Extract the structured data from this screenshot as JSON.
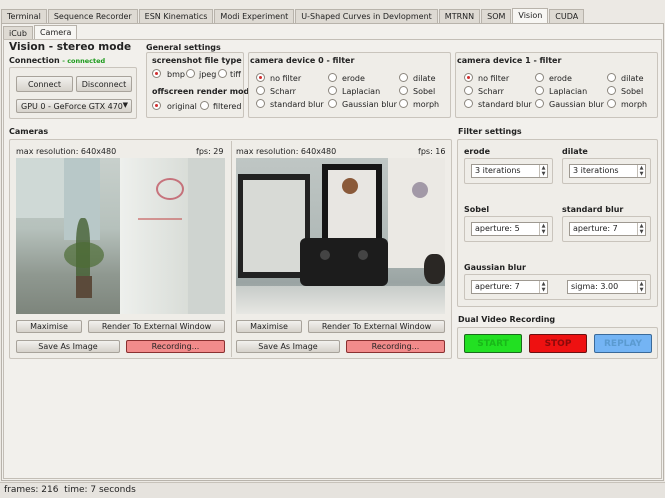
{
  "tabs_top": [
    "Terminal",
    "Sequence Recorder",
    "ESN Kinematics",
    "Modi Experiment",
    "U-Shaped Curves in Devlopment",
    "MTRNN",
    "SOM",
    "Vision",
    "CUDA"
  ],
  "tabs_sub": [
    "iCub",
    "Camera"
  ],
  "title": "Vision - stereo mode",
  "connection": {
    "label": "Connection",
    "status": "- connected",
    "connect": "Connect",
    "disconnect": "Disconnect",
    "gpu": "GPU 0 - GeForce GTX 470"
  },
  "general": {
    "title": "General settings",
    "screenshot": {
      "title": "screenshot file type",
      "options": [
        "bmp",
        "jpeg",
        "tiff"
      ]
    },
    "offscreen": {
      "title": "offscreen render mode",
      "options": [
        "original",
        "filtered"
      ]
    }
  },
  "filter0": {
    "title": "camera device 0 - filter",
    "options": [
      "no filter",
      "erode",
      "dilate",
      "Scharr",
      "Laplacian",
      "Sobel",
      "standard blur",
      "Gaussian blur",
      "morph"
    ]
  },
  "filter1": {
    "title": "camera device 1 - filter",
    "options": [
      "no filter",
      "erode",
      "dilate",
      "Scharr",
      "Laplacian",
      "Sobel",
      "standard blur",
      "Gaussian blur",
      "morph"
    ]
  },
  "cameras": {
    "title": "Cameras",
    "cam0": {
      "res": "max resolution: 640x480",
      "fps": "fps: 29",
      "maximise": "Maximise",
      "render": "Render To External Window",
      "save": "Save As Image",
      "record": "Recording..."
    },
    "cam1": {
      "res": "max resolution: 640x480",
      "fps": "fps: 16",
      "maximise": "Maximise",
      "render": "Render To External Window",
      "save": "Save As Image",
      "record": "Recording..."
    }
  },
  "filter_settings": {
    "title": "Filter settings",
    "erode": {
      "label": "erode",
      "value": "3 iterations"
    },
    "dilate": {
      "label": "dilate",
      "value": "3 iterations"
    },
    "sobel": {
      "label": "Sobel",
      "value": "aperture: 5"
    },
    "std_blur": {
      "label": "standard blur",
      "value": "aperture: 7"
    },
    "gauss": {
      "label": "Gaussian blur",
      "aperture": "aperture: 7",
      "sigma": "sigma: 3.00"
    }
  },
  "dual": {
    "title": "Dual Video Recording",
    "start": "START",
    "stop": "STOP",
    "replay": "REPLAY"
  },
  "status_bar": "frames: 216  time: 7 seconds",
  "colors": {
    "recording": "#f28b8b",
    "start": "#22e022",
    "stop": "#ee1111",
    "replay": "#74b4f4",
    "selected_radio": "#d03030"
  }
}
